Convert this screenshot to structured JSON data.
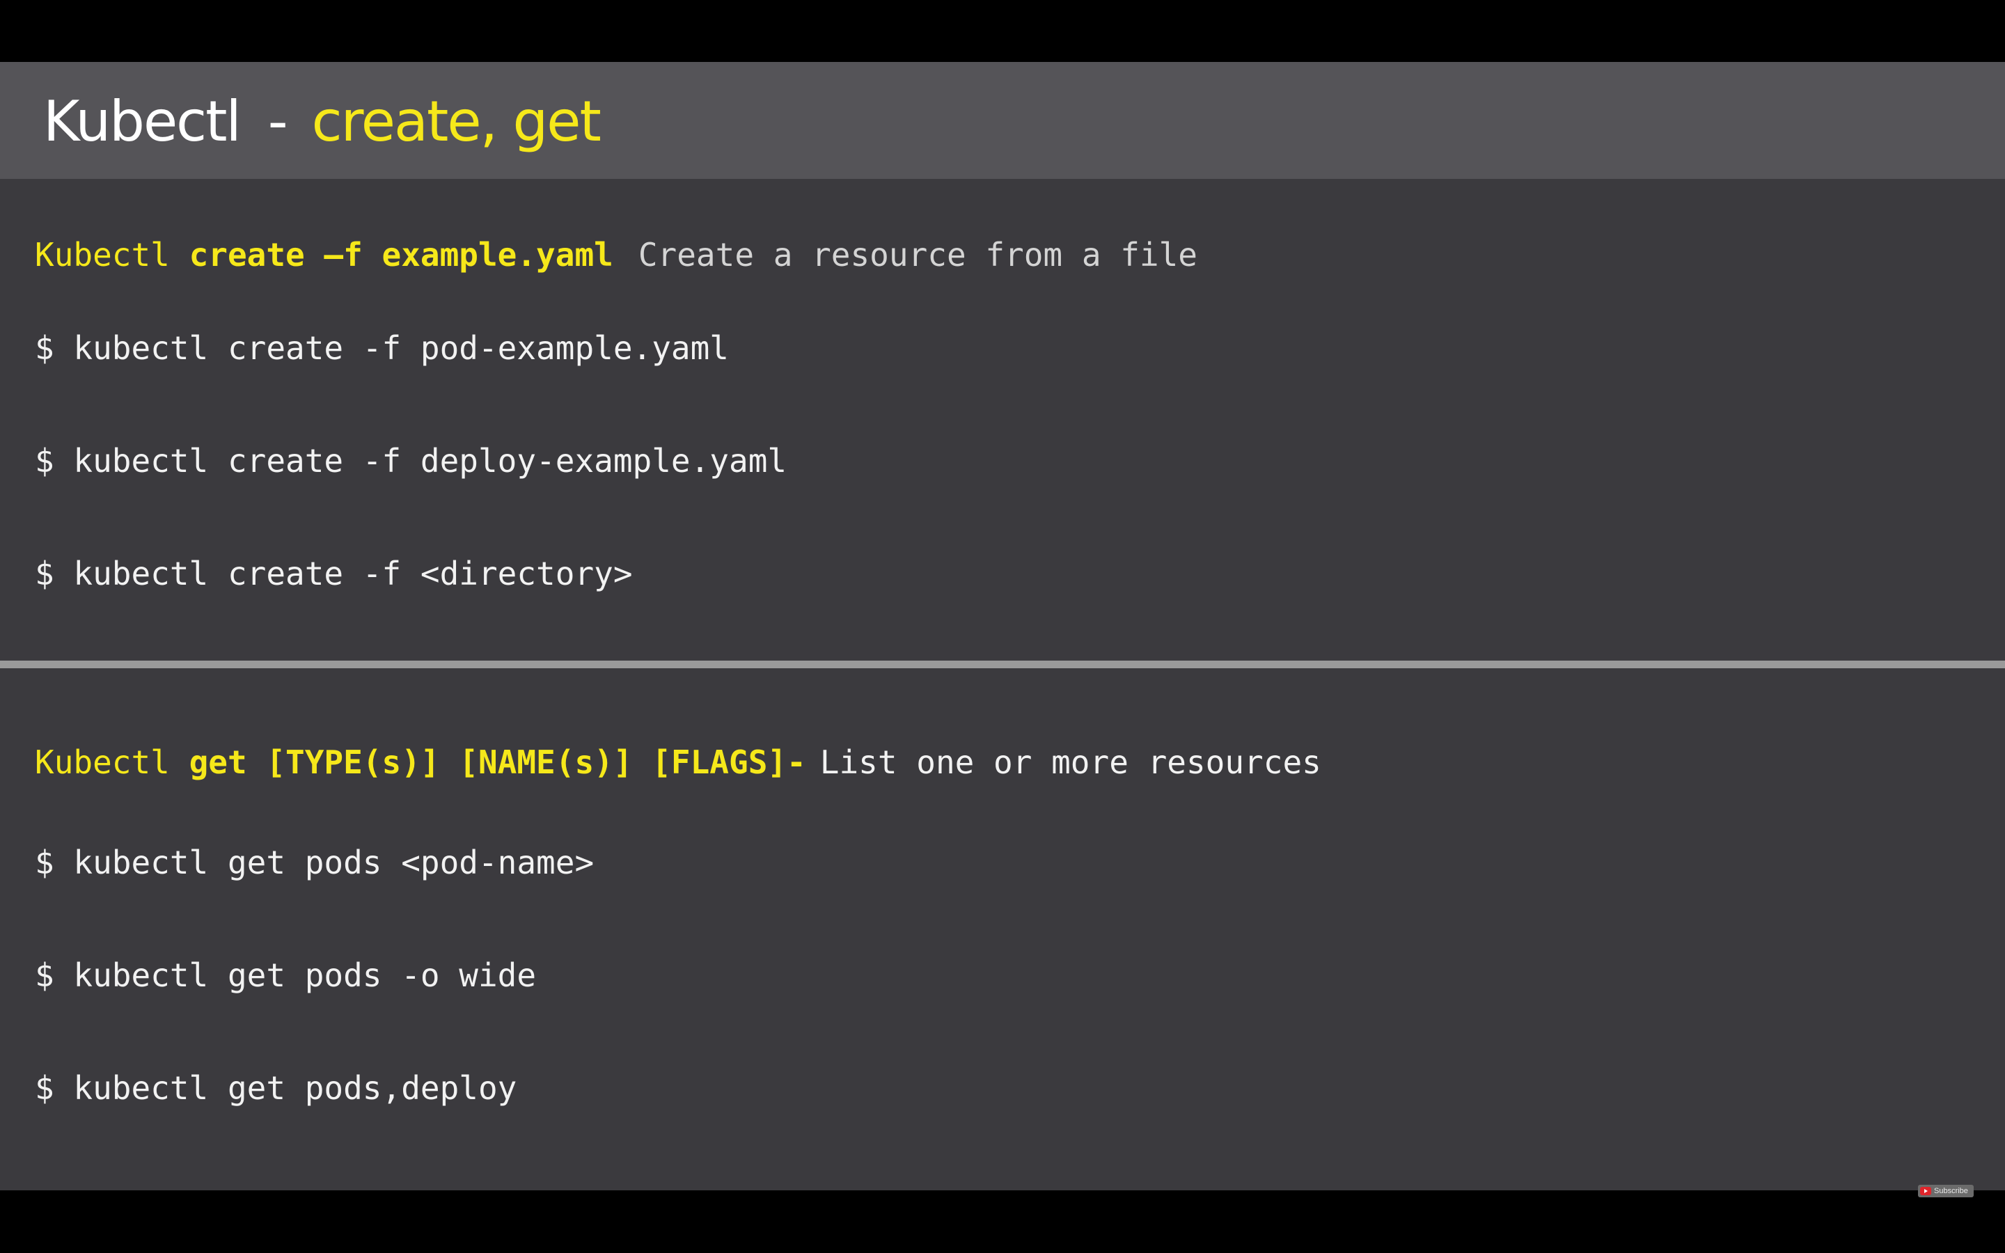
{
  "title": {
    "main": "Kubectl",
    "separator": "-",
    "highlight": "create, get"
  },
  "create_section": {
    "heading_prefix": "Kubectl ",
    "heading_cmd": "create –f example.yaml",
    "heading_desc": "Create a resource from a file",
    "commands": [
      "$ kubectl create -f pod-example.yaml",
      "$ kubectl create -f deploy-example.yaml",
      "$ kubectl create -f <directory>"
    ]
  },
  "get_section": {
    "heading_prefix": "Kubectl ",
    "heading_cmd": "get [TYPE(s)] [NAME(s)] [FLAGS]-",
    "heading_desc": "List one or more resources",
    "commands": [
      "$ kubectl get pods <pod-name>",
      "$ kubectl get pods -o wide",
      "$ kubectl get pods,deploy"
    ]
  },
  "subscribe": {
    "label": "Subscribe",
    "icon": "youtube-icon"
  },
  "colors": {
    "accent_yellow": "#f6e81a",
    "slide_background": "#3b3a3e",
    "header_background": "#555458",
    "divider": "#9a9a9a"
  }
}
